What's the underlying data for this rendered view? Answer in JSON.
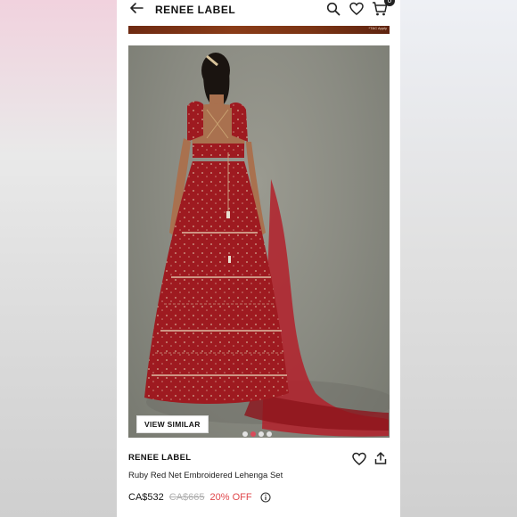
{
  "header": {
    "title": "RENEE LABEL",
    "cart_count": "0",
    "icons": [
      "back-arrow-icon",
      "search-icon",
      "heart-icon",
      "cart-icon"
    ]
  },
  "banner": {
    "caption": "*T&C Apply"
  },
  "gallery": {
    "view_similar_label": "VIEW SIMILAR",
    "slide_count": 4,
    "active_slide": 2
  },
  "product": {
    "brand": "RENEE LABEL",
    "name": "Ruby Red Net Embroidered Lehenga Set",
    "price": "CA$532",
    "original_price": "CA$665",
    "discount": "20% OFF"
  },
  "colors": {
    "accent": "#e0474b",
    "dress": "#9e1a20",
    "active_dot": "#d84a5a"
  }
}
